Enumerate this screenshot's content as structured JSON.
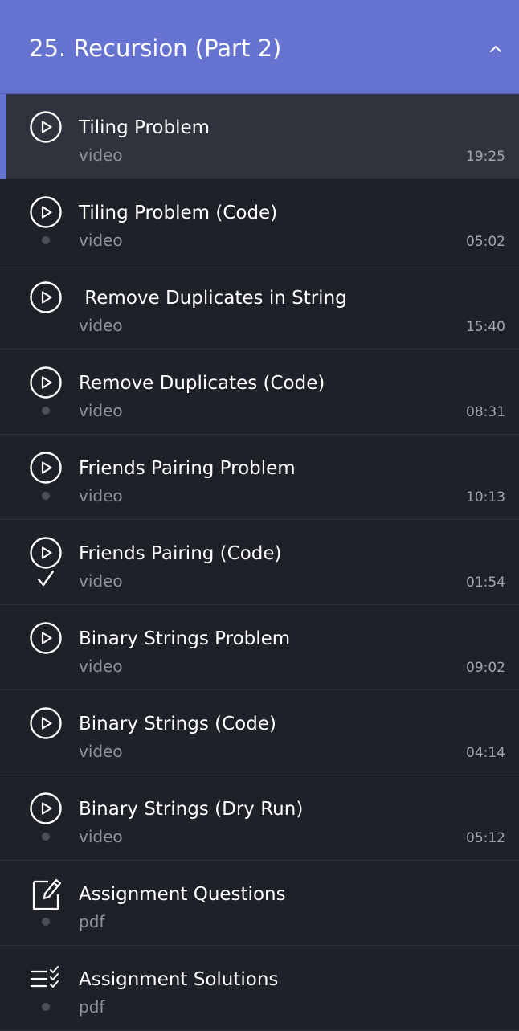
{
  "section": {
    "title": "25. Recursion (Part 2)",
    "icon": "chevron-up-icon"
  },
  "colors": {
    "accent": "#6673d1",
    "background": "#1f2128",
    "active_row": "#2f333d"
  },
  "lessons": [
    {
      "title": "Tiling Problem",
      "type": "video",
      "duration": "19:25",
      "icon": "play-circle-icon",
      "status": "none",
      "active": true
    },
    {
      "title": "Tiling Problem (Code)",
      "type": "video",
      "duration": "05:02",
      "icon": "play-circle-icon",
      "status": "dot",
      "active": false
    },
    {
      "title": " Remove Duplicates in String",
      "type": "video",
      "duration": "15:40",
      "icon": "play-circle-icon",
      "status": "none",
      "active": false
    },
    {
      "title": "Remove Duplicates (Code)",
      "type": "video",
      "duration": "08:31",
      "icon": "play-circle-icon",
      "status": "dot",
      "active": false
    },
    {
      "title": "Friends Pairing Problem",
      "type": "video",
      "duration": "10:13",
      "icon": "play-circle-icon",
      "status": "dot",
      "active": false
    },
    {
      "title": "Friends Pairing (Code)",
      "type": "video",
      "duration": "01:54",
      "icon": "play-circle-icon",
      "status": "check",
      "active": false
    },
    {
      "title": "Binary Strings Problem",
      "type": "video",
      "duration": "09:02",
      "icon": "play-circle-icon",
      "status": "none",
      "active": false
    },
    {
      "title": "Binary Strings (Code)",
      "type": "video",
      "duration": "04:14",
      "icon": "play-circle-icon",
      "status": "none",
      "active": false
    },
    {
      "title": "Binary Strings (Dry Run)",
      "type": "video",
      "duration": "05:12",
      "icon": "play-circle-icon",
      "status": "dot",
      "active": false
    },
    {
      "title": "Assignment Questions",
      "type": "pdf",
      "duration": "",
      "icon": "edit-document-icon",
      "status": "dot",
      "active": false
    },
    {
      "title": "Assignment Solutions",
      "type": "pdf",
      "duration": "",
      "icon": "checklist-icon",
      "status": "dot",
      "active": false
    }
  ]
}
